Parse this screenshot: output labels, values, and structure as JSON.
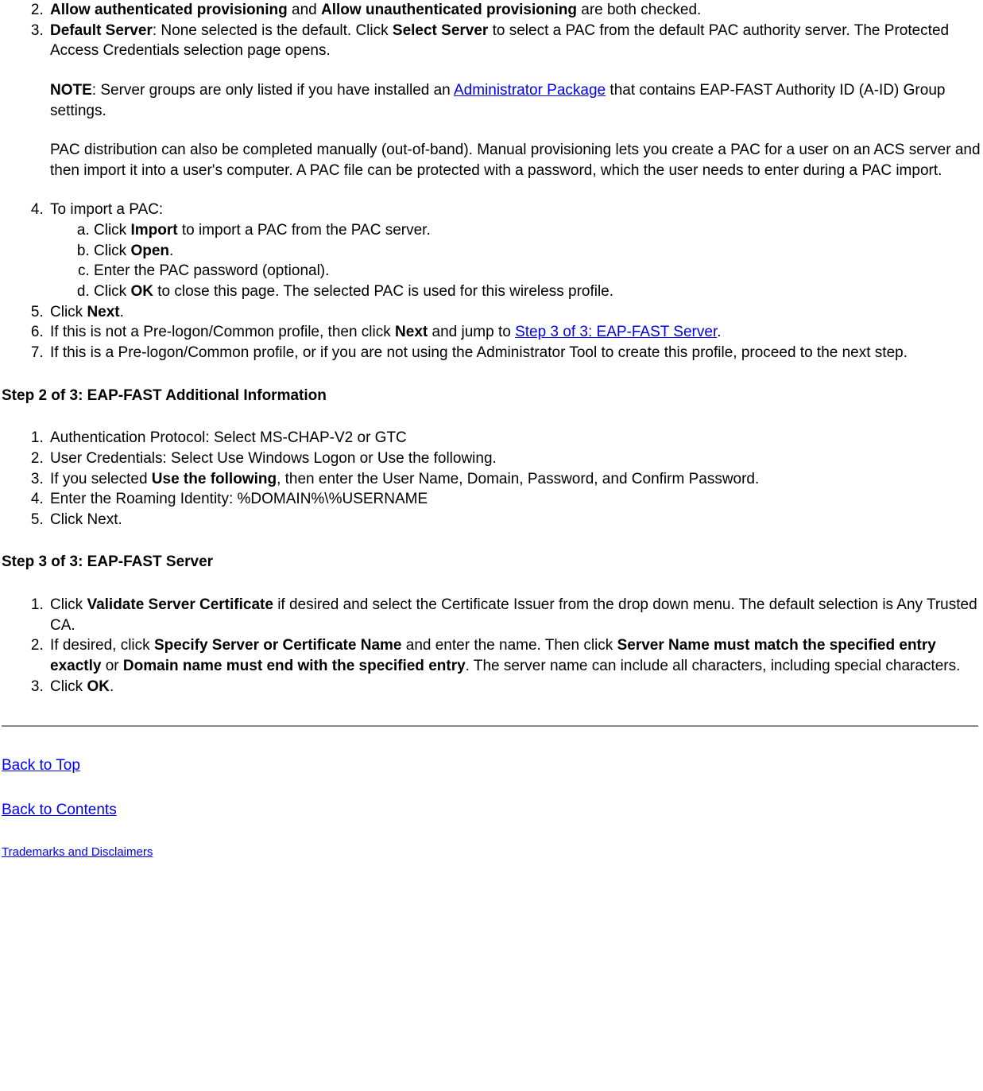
{
  "l1": {
    "item2": {
      "b1": "Allow authenticated provisioning",
      "mid": " and ",
      "b2": "Allow unauthenticated provisioning",
      "tail": " are both checked."
    },
    "item3": {
      "b1": "Default Server",
      "t1": ": None selected is the default. Click ",
      "b2": "Select Server",
      "t2": " to select a PAC from the default PAC authority server. The Protected Access Credentials selection page opens.",
      "note_b": "NOTE",
      "note_t1": ": Server groups are only listed if you have installed an ",
      "note_link": "Administrator Package",
      "note_t2": " that contains EAP-FAST Authority ID (A-ID) Group settings.",
      "pac_para": "PAC distribution can also be completed manually (out-of-band). Manual provisioning lets you create a PAC for a user on an ACS server and then import it into a user's computer. A PAC file can be protected with a password, which the user needs to enter during a PAC import."
    },
    "item4": {
      "lead": "To import a PAC:",
      "a_pre": "Click ",
      "a_b": "Import",
      "a_post": " to import a PAC from the PAC server.",
      "b_pre": "Click ",
      "b_b": "Open",
      "b_post": ".",
      "c": "Enter the PAC password (optional).",
      "d_pre": "Click ",
      "d_b": "OK",
      "d_post": " to close this page. The selected PAC is used for this wireless profile."
    },
    "item5": {
      "pre": "Click ",
      "b": "Next",
      "post": "."
    },
    "item6": {
      "t1": "If this is not a Pre-logon/Common profile, then click ",
      "b": "Next",
      "t2": " and jump to ",
      "link": "Step 3 of 3: EAP-FAST Server",
      "t3": "."
    },
    "item7": "If this is a Pre-logon/Common profile, or if you are not using the Administrator Tool to create this profile, proceed to the next step."
  },
  "step2_heading": "Step 2 of 3: EAP-FAST Additional Information",
  "l2": {
    "i1": "Authentication Protocol: Select MS-CHAP-V2 or GTC",
    "i2": "User Credentials: Select Use Windows Logon or Use the following.",
    "i3_t1": "If you selected ",
    "i3_b": "Use the following",
    "i3_t2": ", then enter the User Name, Domain, Password, and Confirm Password.",
    "i4": "Enter the Roaming Identity: %DOMAIN%\\%USERNAME",
    "i5": "Click Next."
  },
  "step3_heading": "Step 3 of 3: EAP-FAST Server",
  "l3": {
    "i1_t1": "Click ",
    "i1_b": "Validate Server Certificate",
    "i1_t2": " if desired and select the Certificate Issuer from the drop down menu. The default selection is Any Trusted CA.",
    "i2_t1": "If desired, click ",
    "i2_b1": "Specify Server or Certificate Name",
    "i2_t2": " and enter the name. Then click ",
    "i2_b2": "Server Name must match the specified entry exactly",
    "i2_t3": " or ",
    "i2_b3": "Domain name must end with the specified entry",
    "i2_t4": ". The server name can include all characters, including special characters.",
    "i3_t1": "Click ",
    "i3_b": "OK",
    "i3_t2": "."
  },
  "footer": {
    "back_top": "Back to Top",
    "back_contents": "Back to Contents",
    "trademarks": "Trademarks and Disclaimers"
  }
}
